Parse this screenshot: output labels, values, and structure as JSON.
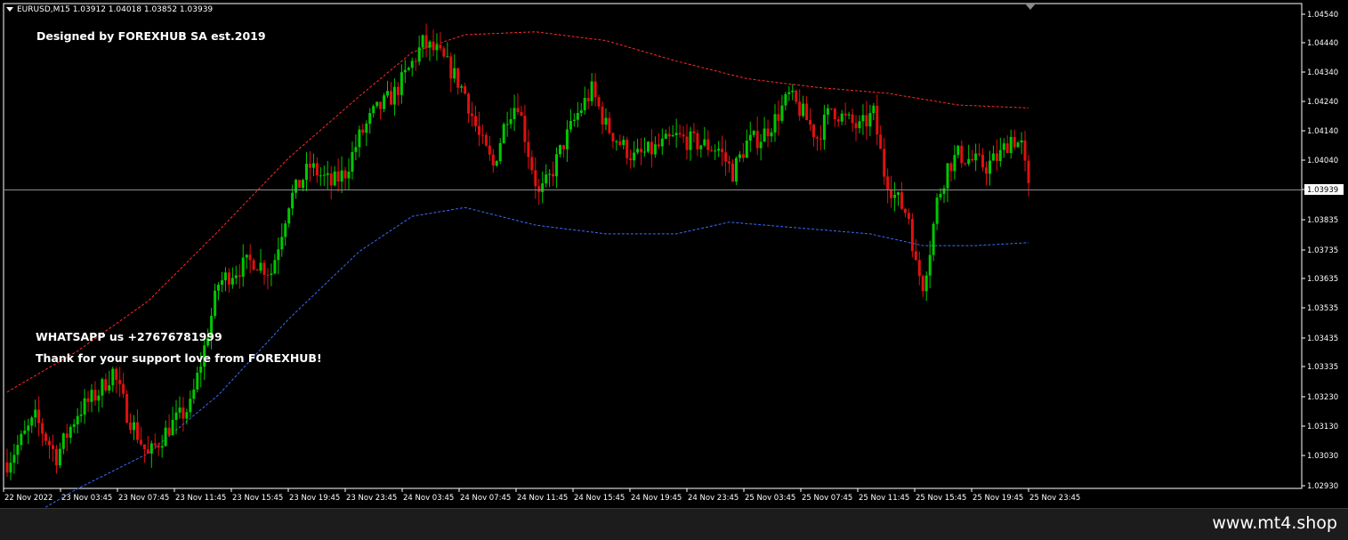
{
  "window": {
    "symbol_info": "EURUSD,M15  1.03912 1.04018 1.03852 1.03939"
  },
  "overlay": {
    "designer": "Designed by FOREXHUB SA est.2019",
    "whatsapp": "WHATSAPP us +27676781999",
    "thanks": "Thank for your support love from FOREXHUB!"
  },
  "footer": {
    "site": "www.mt4.shop"
  },
  "colors": {
    "background": "#000000",
    "bull_candle": "#00c800",
    "bear_candle": "#e01010",
    "upper_band": "#ff2a2a",
    "lower_band": "#3a6cff",
    "grid_axis": "#ffffff",
    "current_price_line": "#8c8c8c"
  },
  "chart_data": {
    "type": "candlestick",
    "symbol": "EURUSD",
    "timeframe": "M15",
    "last_price_label": "1.03939",
    "ylim": [
      1.029,
      1.0457
    ],
    "y_ticks": [
      "1.04540",
      "1.04440",
      "1.04340",
      "1.04240",
      "1.04140",
      "1.04040",
      "1.03939",
      "1.03835",
      "1.03735",
      "1.03635",
      "1.03535",
      "1.03435",
      "1.03335",
      "1.03230",
      "1.03130",
      "1.03030",
      "1.02930"
    ],
    "x_ticks": [
      "22 Nov 2022",
      "23 Nov 03:45",
      "23 Nov 07:45",
      "23 Nov 11:45",
      "23 Nov 15:45",
      "23 Nov 19:45",
      "23 Nov 23:45",
      "24 Nov 03:45",
      "24 Nov 07:45",
      "24 Nov 11:45",
      "24 Nov 15:45",
      "24 Nov 19:45",
      "24 Nov 23:45",
      "25 Nov 03:45",
      "25 Nov 07:45",
      "25 Nov 11:45",
      "25 Nov 15:45",
      "25 Nov 19:45",
      "25 Nov 23:45"
    ],
    "close_anchors": [
      [
        0,
        1.0301
      ],
      [
        8,
        1.0316
      ],
      [
        14,
        1.0303
      ],
      [
        20,
        1.0318
      ],
      [
        26,
        1.0325
      ],
      [
        30,
        1.0332
      ],
      [
        34,
        1.0318
      ],
      [
        40,
        1.0303
      ],
      [
        46,
        1.0313
      ],
      [
        52,
        1.032
      ],
      [
        56,
        1.034
      ],
      [
        60,
        1.0362
      ],
      [
        64,
        1.0366
      ],
      [
        70,
        1.037
      ],
      [
        75,
        1.0366
      ],
      [
        80,
        1.039
      ],
      [
        86,
        1.0402
      ],
      [
        92,
        1.0396
      ],
      [
        96,
        1.04
      ],
      [
        100,
        1.0412
      ],
      [
        104,
        1.042
      ],
      [
        110,
        1.0427
      ],
      [
        114,
        1.0435
      ],
      [
        118,
        1.0444
      ],
      [
        122,
        1.0441
      ],
      [
        126,
        1.0435
      ],
      [
        130,
        1.0427
      ],
      [
        134,
        1.0412
      ],
      [
        138,
        1.0402
      ],
      [
        142,
        1.042
      ],
      [
        145,
        1.0424
      ],
      [
        148,
        1.0407
      ],
      [
        151,
        1.0392
      ],
      [
        154,
        1.0398
      ],
      [
        158,
        1.041
      ],
      [
        162,
        1.042
      ],
      [
        166,
        1.0428
      ],
      [
        170,
        1.0416
      ],
      [
        174,
        1.041
      ],
      [
        178,
        1.0405
      ],
      [
        184,
        1.0408
      ],
      [
        190,
        1.0412
      ],
      [
        196,
        1.041
      ],
      [
        202,
        1.0408
      ],
      [
        206,
        1.04
      ],
      [
        210,
        1.041
      ],
      [
        214,
        1.0412
      ],
      [
        218,
        1.0418
      ],
      [
        222,
        1.0426
      ],
      [
        226,
        1.042
      ],
      [
        230,
        1.0412
      ],
      [
        234,
        1.0422
      ],
      [
        238,
        1.0418
      ],
      [
        242,
        1.0415
      ],
      [
        246,
        1.042
      ],
      [
        249,
        1.04
      ],
      [
        252,
        1.0392
      ],
      [
        256,
        1.0385
      ],
      [
        258,
        1.0368
      ],
      [
        260,
        1.0362
      ],
      [
        262,
        1.0374
      ],
      [
        264,
        1.039
      ],
      [
        267,
        1.0402
      ],
      [
        270,
        1.0406
      ],
      [
        274,
        1.0404
      ],
      [
        278,
        1.0402
      ],
      [
        282,
        1.0406
      ],
      [
        285,
        1.0412
      ],
      [
        288,
        1.0409
      ],
      [
        290,
        1.0394
      ]
    ],
    "bands": {
      "upper": {
        "anchors": [
          [
            0,
            1.0325
          ],
          [
            20,
            1.0339
          ],
          [
            40,
            1.0356
          ],
          [
            60,
            1.038
          ],
          [
            80,
            1.0405
          ],
          [
            100,
            1.0426
          ],
          [
            115,
            1.0441
          ],
          [
            130,
            1.0447
          ],
          [
            150,
            1.0448
          ],
          [
            170,
            1.0445
          ],
          [
            190,
            1.0438
          ],
          [
            210,
            1.0432
          ],
          [
            230,
            1.0429
          ],
          [
            250,
            1.0427
          ],
          [
            270,
            1.0423
          ],
          [
            290,
            1.0422
          ]
        ]
      },
      "lower": {
        "anchors": [
          [
            0,
            1.0278
          ],
          [
            20,
            1.0292
          ],
          [
            40,
            1.0304
          ],
          [
            60,
            1.0324
          ],
          [
            80,
            1.035
          ],
          [
            100,
            1.0373
          ],
          [
            115,
            1.0385
          ],
          [
            130,
            1.0388
          ],
          [
            150,
            1.0382
          ],
          [
            170,
            1.0379
          ],
          [
            190,
            1.0379
          ],
          [
            205,
            1.0383
          ],
          [
            225,
            1.0381
          ],
          [
            245,
            1.0379
          ],
          [
            260,
            1.0375
          ],
          [
            275,
            1.0375
          ],
          [
            290,
            1.0376
          ]
        ]
      }
    }
  }
}
